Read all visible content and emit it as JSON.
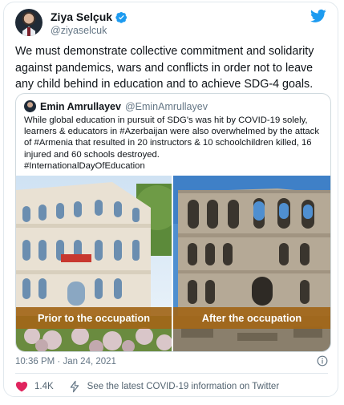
{
  "author": {
    "name": "Ziya Selçuk",
    "handle": "@ziyaselcuk"
  },
  "tweet": {
    "text": "We must demonstrate collective commitment and solidarity against pandemics, wars and conflicts in order not to leave any child behind in education and to achieve SDG-4 goals.",
    "timestamp": "10:36 PM · Jan 24, 2021"
  },
  "quoted": {
    "name": "Emin Amrullayev",
    "handle": "@EminAmrullayev",
    "text": "While global education in pursuit of SDG's was hit by COVID-19 solely, learners & educators in #Azerbaijan were also overwhelmed by the attack of #Armenia that resulted in 20 instructors & 10 schoolchildren killed, 16 injured and 60 schools destroyed.",
    "hashtag": "#InternationalDayOfEducation",
    "photos": [
      {
        "caption": "Prior to the occupation"
      },
      {
        "caption": "After the occupation"
      }
    ]
  },
  "actions": {
    "like_count": "1.4K",
    "covid_link": "See the latest COVID-19 information on Twitter"
  },
  "colors": {
    "twitter_blue": "#1d9bf0",
    "like_red": "#e0245e",
    "caption_bg": "#a26618"
  },
  "icons": [
    "twitter-logo-icon",
    "verified-badge-icon",
    "info-icon",
    "heart-icon",
    "lightning-icon"
  ]
}
